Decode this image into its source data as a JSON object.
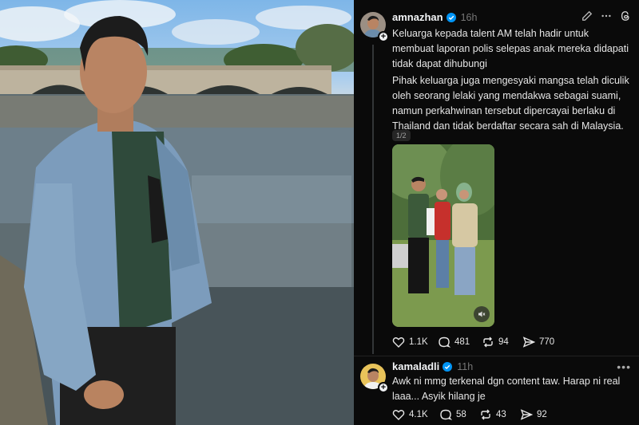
{
  "post": {
    "username": "amnazhan",
    "time": "16h",
    "paragraph1_line1": "Keluarga kepada talent AM telah hadir untuk",
    "paragraph1_line2": "membuat laporan polis selepas anak mereka didapati",
    "paragraph1_line3": "tidak dapat dihubungi",
    "paragraph2_line1": "Pihak keluarga juga mengesyaki mangsa telah diculik",
    "paragraph2_line2": "oleh seorang lelaki yang mendakwa sebagai suami,",
    "paragraph2_line3": "namun perkahwinan tersebut dipercayai berlaku di",
    "paragraph2_line4": "Thailand dan tidak berdaftar secara sah di Malaysia.",
    "media_counter": "1/2",
    "likes": "1.1K",
    "comments": "481",
    "reposts": "94",
    "shares": "770"
  },
  "reply": {
    "username": "kamaladli",
    "time": "11h",
    "text_line1": "Awk ni mmg terkenal dgn content taw. Harap ni real",
    "text_line2": "laaa... Asyik hilang je",
    "likes": "4.1K",
    "comments": "58",
    "reposts": "43",
    "shares": "92"
  },
  "icons": {
    "edit": "pencil-icon",
    "more": "more-icon",
    "app": "threads-logo-icon",
    "verified": "verified-badge-icon",
    "like": "heart-icon",
    "comment": "comment-icon",
    "repost": "repost-icon",
    "share": "share-icon",
    "mute": "muted-speaker-icon"
  },
  "colors": {
    "background": "#0a0a0a",
    "text": "#f3f5f7",
    "muted": "#777777",
    "verified": "#0095f6"
  }
}
